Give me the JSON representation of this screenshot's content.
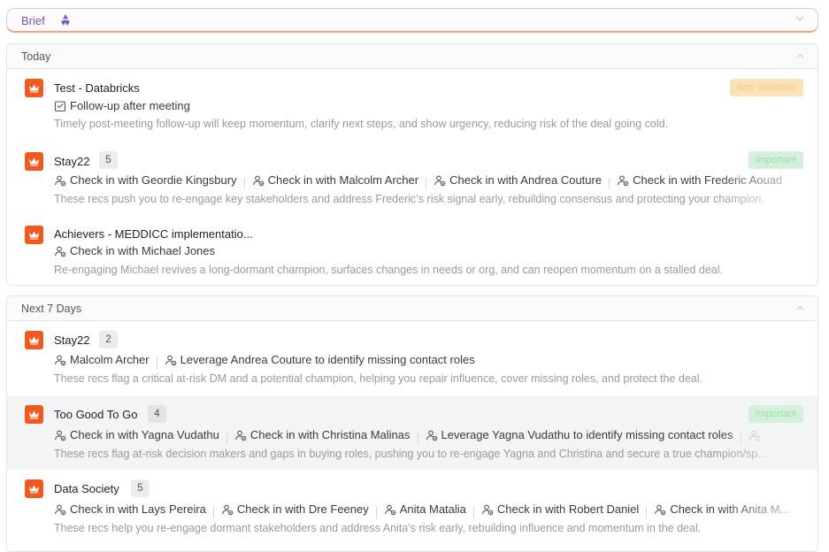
{
  "brief": {
    "label": "Brief"
  },
  "sections": {
    "today": {
      "title": "Today",
      "recs": [
        {
          "title": "Test - Databricks",
          "badge": "time sensitive",
          "actions": [
            "Follow-up after meeting"
          ],
          "description": "Timely post-meeting follow-up will keep momentum, clarify next steps, and show urgency, reducing risk of the deal going cold."
        },
        {
          "title": "Stay22",
          "count": "5",
          "badge": "important",
          "actions": [
            "Check in with Geordie Kingsbury",
            "Check in with Malcolm Archer",
            "Check in with Andrea Couture",
            "Check in with Frederic Aouad"
          ],
          "description": "These recs push you to re-engage key stakeholders and address Frederic’s risk signal early, rebuilding consensus and protecting your champion."
        },
        {
          "title": "Achievers - MEDDICC implementatio...",
          "actions": [
            "Check in with Michael Jones"
          ],
          "description": "Re-engaging Michael revives a long-dormant champion, surfaces changes in needs or org, and can reopen momentum on a stalled deal."
        }
      ]
    },
    "next7": {
      "title": "Next 7 Days",
      "recs": [
        {
          "title": "Stay22",
          "count": "2",
          "actions": [
            "Malcolm Archer",
            "Leverage Andrea Couture to identify missing contact roles"
          ],
          "description": "These recs flag a critical at-risk DM and a potential champion, helping you repair influence, cover missing roles, and protect the deal."
        },
        {
          "title": "Too Good To Go",
          "count": "4",
          "badge": "important",
          "actions": [
            "Check in with Yagna Vudathu",
            "Check in with Christina Malinas",
            "Leverage Yagna Vudathu to identify missing contact roles"
          ],
          "description": "These recs flag at-risk decision makers and gaps in buying roles, pushing you to re-engage Yagna and Christina and secure a true champion/sp..."
        },
        {
          "title": "Data Society",
          "count": "5",
          "actions": [
            "Check in with Lays Pereira",
            "Check in with Dre Feeney",
            "Anita Matalia",
            "Check in with Robert Daniel",
            "Check in with Anita M..."
          ],
          "description": "These recs help you re-engage dormant stakeholders and address Anita’s risk early, rebuilding influence and momentum in the deal."
        }
      ]
    }
  },
  "colors": {
    "accent": "#f05a1e",
    "brief": "#7a4fb5",
    "important": "#d3f1da",
    "time_sensitive": "#fde2b8"
  },
  "icons": [
    "brief-logo-icon",
    "chevron-up-icon",
    "crown-icon",
    "person-check-icon",
    "calendar-check-icon"
  ]
}
